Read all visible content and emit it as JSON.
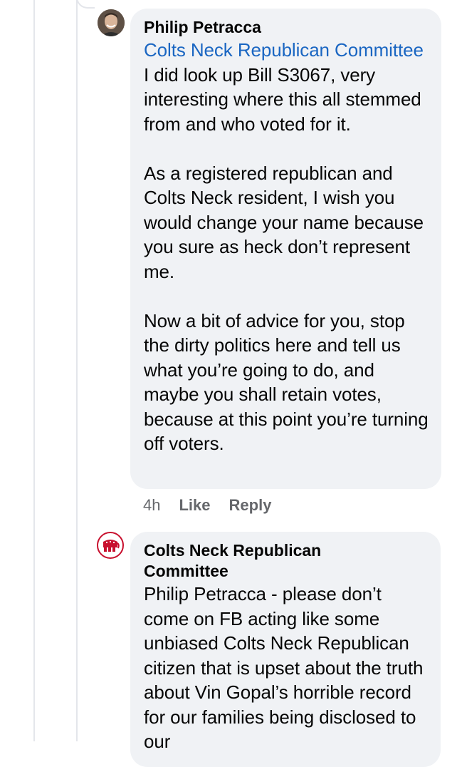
{
  "comments": [
    {
      "author": "Philip Petracca",
      "mention": "Colts Neck Republican Committee",
      "paragraphs": [
        "I did look up Bill S3067, very interesting where this all stemmed from and who voted for it.",
        "As a registered republican and Colts Neck resident, I wish you would change your name because you sure as heck don’t represent me.",
        "Now a bit of advice for you, stop the dirty politics here and tell us what you’re going to do, and maybe you shall retain votes, because at this point you’re turning off voters."
      ],
      "time": "4h",
      "like_label": "Like",
      "reply_label": "Reply"
    },
    {
      "author": "Colts Neck Republican Committee",
      "text": "Philip Petracca - please don’t come on FB acting like some unbiased Colts Neck Republican citizen that is upset about the truth about Vin Gopal’s horrible record for our families being disclosed to our"
    }
  ],
  "colors": {
    "bubble": "#f0f2f5",
    "mention": "#1a66c2",
    "meta": "#65676b",
    "logo_red": "#c8102e"
  },
  "icons": {
    "avatar_1": "profile-photo",
    "avatar_2": "republican-elephant-logo"
  }
}
